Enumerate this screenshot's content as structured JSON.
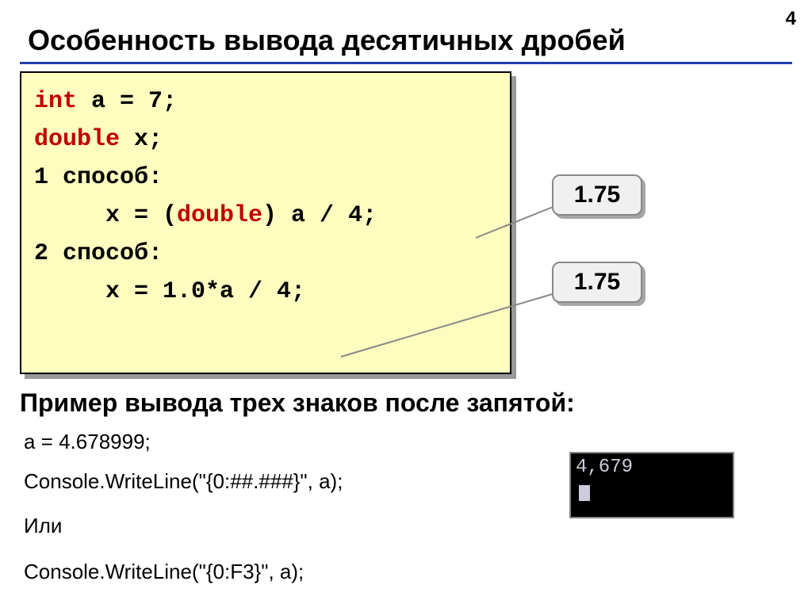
{
  "page_number": "4",
  "title": "Особенность вывода десятичных дробей",
  "code": {
    "line1": {
      "kw": "int",
      "rest": " a = 7;"
    },
    "line2": {
      "kw": "double",
      "rest": " x;"
    },
    "line3": "1 способ:",
    "line4_pre": "x = (",
    "line4_kw": "double",
    "line4_post": ") a / 4;",
    "line5": "2 способ:",
    "line6": "x = 1.0*a / 4;"
  },
  "callout1": "1.75",
  "callout2": "1.75",
  "subtitle": "Пример вывода трех знаков после запятой:",
  "examples": {
    "l1": "a = 4.678999;",
    "l2": "Console.WriteLine(\"{0:##.###}\", a);",
    "l3": "Или",
    "l4": "Console.WriteLine(\"{0:F3}\", a);"
  },
  "console_output": "4,679"
}
